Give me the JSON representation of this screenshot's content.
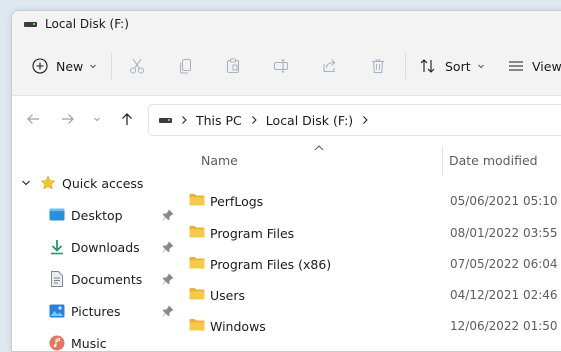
{
  "window": {
    "title": "Local Disk (F:)"
  },
  "commandbar": {
    "new_label": "New",
    "sort_label": "Sort",
    "view_label": "View"
  },
  "address": {
    "crumbs": [
      "This PC",
      "Local Disk (F:)"
    ]
  },
  "sidebar": {
    "quick_access": "Quick access",
    "items": [
      {
        "label": "Desktop",
        "icon": "desktop-icon",
        "pinned": true
      },
      {
        "label": "Downloads",
        "icon": "download-icon",
        "pinned": true
      },
      {
        "label": "Documents",
        "icon": "document-icon",
        "pinned": true
      },
      {
        "label": "Pictures",
        "icon": "picture-icon",
        "pinned": true
      },
      {
        "label": "Music",
        "icon": "music-icon",
        "pinned": false
      }
    ]
  },
  "filelist": {
    "columns": {
      "name": "Name",
      "date": "Date modified"
    },
    "rows": [
      {
        "name": "PerfLogs",
        "date": "05/06/2021 05:10"
      },
      {
        "name": "Program Files",
        "date": "08/01/2022 03:55"
      },
      {
        "name": "Program Files (x86)",
        "date": "07/05/2022 06:04"
      },
      {
        "name": "Users",
        "date": "04/12/2021 02:46"
      },
      {
        "name": "Windows",
        "date": "12/06/2022 01:50"
      }
    ]
  },
  "colors": {
    "folder": "#f7c948",
    "folder_tab": "#e8b037",
    "accent": "#0067c0",
    "disabled_icon": "#a8b3c2"
  }
}
